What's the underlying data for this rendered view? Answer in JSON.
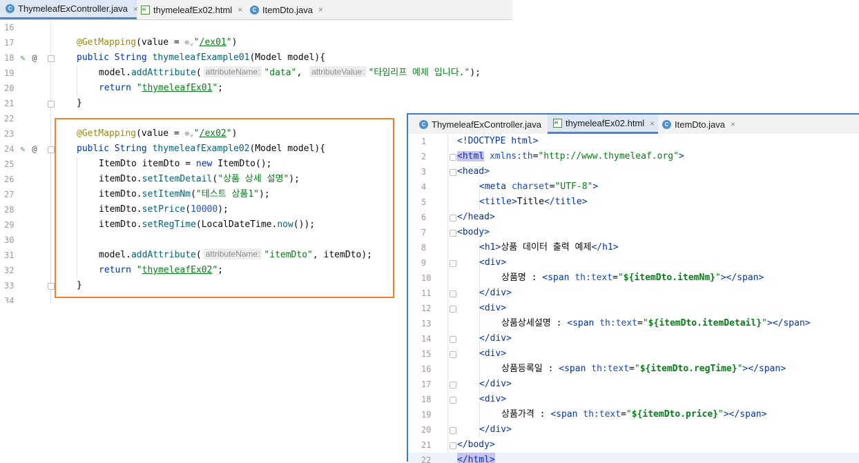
{
  "left_tabs": [
    {
      "label": "ThymeleafExController.java",
      "kind": "java",
      "active": true
    },
    {
      "label": "thymeleafEx02.html",
      "kind": "html",
      "active": false
    },
    {
      "label": "ItemDto.java",
      "kind": "java",
      "active": false
    }
  ],
  "right_tabs": [
    {
      "label": "ThymeleafExController.java",
      "kind": "java",
      "active": false
    },
    {
      "label": "thymeleafEx02.html",
      "kind": "html",
      "active": true
    },
    {
      "label": "ItemDto.java",
      "kind": "java",
      "active": false
    }
  ],
  "tab_close_glyph": "×",
  "java_editor": {
    "line_numbers": [
      "16",
      "17",
      "18",
      "19",
      "20",
      "21",
      "22",
      "23",
      "24",
      "25",
      "26",
      "27",
      "28",
      "29",
      "30",
      "31",
      "32",
      "33",
      "34"
    ],
    "hints": {
      "attribute_name": "attributeName:",
      "attribute_value": "attributeValue:"
    },
    "code": {
      "ann": "@GetMapping",
      "value_open": "(value = ",
      "globe": "⊕",
      "quote": "\"",
      "url1": "/ex01",
      "url2": "/ex02",
      "close_paren": ")",
      "public": "public",
      "string": "String",
      "method1": "thymeleafExample01",
      "method2": "thymeleafExample02",
      "params": "(Model model){",
      "model": "model.",
      "addAttribute": "addAttribute",
      "open": "(",
      "str_data": "\"data\"",
      "comma": ", ",
      "str_value": "\"타임리프 예제 입니다.\"",
      "semi_close": ");",
      "return": "return",
      "ret1": "thymeleafEx01",
      "ret2": "thymeleafEx02",
      "semi": ";",
      "brace": "}",
      "itemdto_decl": "ItemDto itemDto = ",
      "new": "new",
      "new_call": " ItemDto();",
      "itemdto": "itemDto.",
      "setItemDetail": "setItemDetail",
      "str_detail": "\"상품 상세 설명\"",
      "setItemNm": "setItemNm",
      "str_nm": "\"테스트 상품1\"",
      "setPrice": "setPrice",
      "num_price": "10000",
      "setRegTime": "setRegTime",
      "ldt": "LocalDateTime.",
      "now": "now",
      "now_close": "());",
      "str_itemdto": "\"itemDto\"",
      "itemdto_arg": ", itemDto);"
    }
  },
  "html_editor": {
    "line_numbers": [
      "1",
      "2",
      "3",
      "4",
      "5",
      "6",
      "7",
      "8",
      "9",
      "10",
      "11",
      "12",
      "13",
      "14",
      "15",
      "16",
      "17",
      "18",
      "19",
      "20",
      "21",
      "22"
    ],
    "code": {
      "doctype": "<!DOCTYPE html>",
      "lt": "<",
      "gt": ">",
      "lts": "</",
      "html": "html",
      "xmlns": "xmlns:th",
      "eq": "=",
      "xmlns_val": "\"http://www.thymeleaf.org\"",
      "head": "head",
      "meta": "meta",
      "charset": "charset",
      "charset_val": "\"UTF-8\"",
      "title": "title",
      "title_text": "Title",
      "body": "body",
      "h1": "h1",
      "h1_text": "상품 데이터 출력 예제",
      "div": "div",
      "span": "span",
      "thtext": "th:text",
      "q": "\"",
      "label_nm": "상품명 : ",
      "expr_nm": "${itemDto.itemNm}",
      "label_detail": "상품상세설명 : ",
      "expr_detail": "${itemDto.itemDetail}",
      "label_reg": "상품등록일 : ",
      "expr_reg": "${itemDto.regTime}",
      "label_price": "상품가격 : ",
      "expr_price": "${itemDto.price}",
      "span_close_open": "\"></",
      "sp": " "
    }
  },
  "colors": {
    "highlight_box": "#f07f2a",
    "right_panel_border": "#3d7bd0"
  }
}
